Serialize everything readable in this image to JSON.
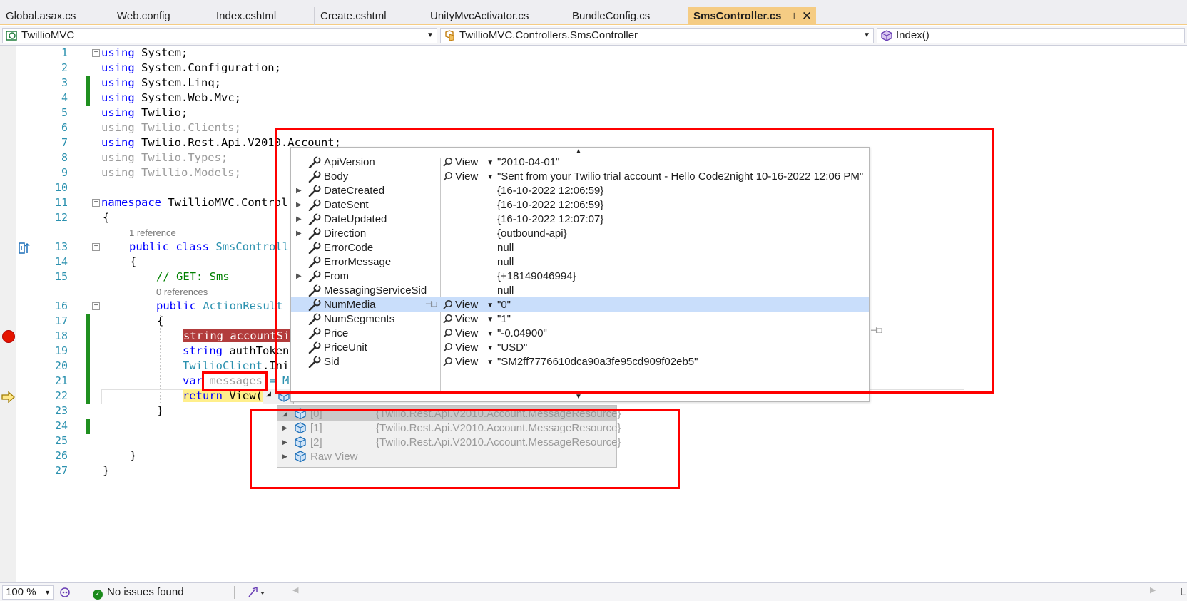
{
  "tabs": [
    {
      "label": "Global.asax.cs",
      "active": false
    },
    {
      "label": "Web.config",
      "active": false
    },
    {
      "label": "Index.cshtml",
      "active": false
    },
    {
      "label": "Create.cshtml",
      "active": false
    },
    {
      "label": "UnityMvcActivator.cs",
      "active": false
    },
    {
      "label": "BundleConfig.cs",
      "active": false
    },
    {
      "label": "SmsController.cs",
      "active": true
    }
  ],
  "tab_icons": {
    "pin": "⭿",
    "close": "✕"
  },
  "navbar": {
    "project": "TwillioMVC",
    "class": "TwillioMVC.Controllers.SmsController",
    "member": "Index()"
  },
  "code": {
    "line_numbers": [
      "1",
      "2",
      "3",
      "4",
      "5",
      "6",
      "7",
      "8",
      "9",
      "10",
      "11",
      "12",
      "13",
      "14",
      "15",
      "16",
      "17",
      "18",
      "19",
      "20",
      "21",
      "22",
      "23",
      "24",
      "25",
      "26",
      "27"
    ],
    "ref1": "1 reference",
    "ref2": "0 references",
    "l1_kw": "using",
    "l1_rest": " System;",
    "l2_kw": "using",
    "l2_rest": " System.Configuration;",
    "l3_kw": "using",
    "l3_rest": " System.Linq;",
    "l4_kw": "using",
    "l4_rest": " System.Web.Mvc;",
    "l5_kw": "using",
    "l5_rest": " Twilio;",
    "l6": "using Twilio.Clients;",
    "l7_kw": "using",
    "l7_rest": " Twilio.Rest.Api.V2010.Account;",
    "l8": "using Twilio.Types;",
    "l9": "using Twillio.Models;",
    "l11_kw": "namespace",
    "l11_rest": " TwillioMVC.Control",
    "l12": "{",
    "l13_kw": "public class",
    "l13_ty": " SmsControll",
    "l14": "{",
    "l15": "// GET: Sms",
    "l16_kw": "public",
    "l16_ty": " ActionResult",
    "l17": "{",
    "l18": "string accountSi",
    "l19_kw": "string",
    "l19_rest": " authToken",
    "l20_ty": "TwilioClient",
    "l20_rest": ".Ini",
    "l21_kw": "var",
    "l21_var": " messages",
    "l21_rest": " = M",
    "l22_kw": "return",
    "l22_rest": " View(",
    "l23": "}",
    "l26": "}",
    "l27": "}"
  },
  "datatip": {
    "rows": [
      {
        "name": "ApiVersion",
        "expandable": false,
        "view": true,
        "value": "\"2010-04-01\"",
        "selected": false
      },
      {
        "name": "Body",
        "expandable": false,
        "view": true,
        "value": "\"Sent from your Twilio trial account - Hello Code2night 10-16-2022 12:06 PM\"",
        "selected": false
      },
      {
        "name": "DateCreated",
        "expandable": true,
        "view": false,
        "value": "{16-10-2022 12:06:59}",
        "selected": false
      },
      {
        "name": "DateSent",
        "expandable": true,
        "view": false,
        "value": "{16-10-2022 12:06:59}",
        "selected": false
      },
      {
        "name": "DateUpdated",
        "expandable": true,
        "view": false,
        "value": "{16-10-2022 12:07:07}",
        "selected": false
      },
      {
        "name": "Direction",
        "expandable": true,
        "view": false,
        "value": "{outbound-api}",
        "selected": false
      },
      {
        "name": "ErrorCode",
        "expandable": false,
        "view": false,
        "value": "null",
        "selected": false
      },
      {
        "name": "ErrorMessage",
        "expandable": false,
        "view": false,
        "value": "null",
        "selected": false
      },
      {
        "name": "From",
        "expandable": true,
        "view": false,
        "value": "{+18149046994}",
        "selected": false
      },
      {
        "name": "MessagingServiceSid",
        "expandable": false,
        "view": false,
        "value": "null",
        "selected": false
      },
      {
        "name": "NumMedia",
        "expandable": false,
        "view": true,
        "value": "\"0\"",
        "selected": true
      },
      {
        "name": "NumSegments",
        "expandable": false,
        "view": true,
        "value": "\"1\"",
        "selected": false
      },
      {
        "name": "Price",
        "expandable": false,
        "view": true,
        "value": "\"-0.04900\"",
        "selected": false
      },
      {
        "name": "PriceUnit",
        "expandable": false,
        "view": true,
        "value": "\"USD\"",
        "selected": false
      },
      {
        "name": "Sid",
        "expandable": false,
        "view": true,
        "value": "\"SM2ff7776610dca90a3fe95cd909f02eb5\"",
        "selected": false
      }
    ],
    "view_label": "View"
  },
  "results": {
    "rows": [
      {
        "name": "[0]",
        "value": "{Twilio.Rest.Api.V2010.Account.MessageResource}",
        "selected": true
      },
      {
        "name": "[1]",
        "value": "{Twilio.Rest.Api.V2010.Account.MessageResource}",
        "selected": false
      },
      {
        "name": "[2]",
        "value": "{Twilio.Rest.Api.V2010.Account.MessageResource}",
        "selected": false
      },
      {
        "name": "Raw View",
        "value": "",
        "selected": false
      }
    ]
  },
  "statusbar": {
    "zoom": "100 %",
    "issues": "No issues found",
    "right_letter": "L"
  },
  "colors": {
    "active_tab": "#f5cc84",
    "breakpoint": "#e51400",
    "highlight_box": "#ff0000",
    "selection": "#c9defb",
    "changed_line": "#1f8f1f"
  }
}
